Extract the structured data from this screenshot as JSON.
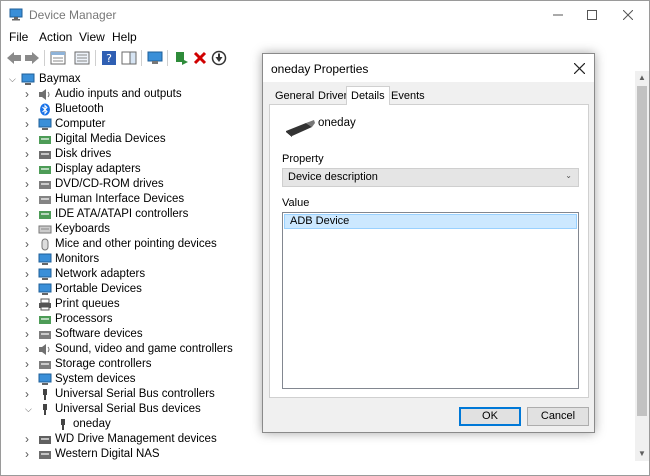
{
  "window": {
    "title": "Device Manager",
    "controls": {
      "minimize": "minimize",
      "maximize": "maximize",
      "close": "close"
    }
  },
  "menu": [
    "File",
    "Action",
    "View",
    "Help"
  ],
  "toolbar": [
    "back-arrow-icon",
    "forward-arrow-icon",
    "properties-icon",
    "show-hidden-icon",
    "help-icon",
    "action-pane-icon",
    "scan-hardware-icon",
    "update-driver-icon",
    "uninstall-icon",
    "disable-icon"
  ],
  "tree": {
    "root": "Baymax",
    "items": [
      {
        "label": "Audio inputs and outputs",
        "icon": "speaker-icon"
      },
      {
        "label": "Bluetooth",
        "icon": "bluetooth-icon"
      },
      {
        "label": "Computer",
        "icon": "monitor-icon"
      },
      {
        "label": "Digital Media Devices",
        "icon": "media-icon"
      },
      {
        "label": "Disk drives",
        "icon": "disk-icon"
      },
      {
        "label": "Display adapters",
        "icon": "display-adapter-icon"
      },
      {
        "label": "DVD/CD-ROM drives",
        "icon": "dvd-icon"
      },
      {
        "label": "Human Interface Devices",
        "icon": "hid-icon"
      },
      {
        "label": "IDE ATA/ATAPI controllers",
        "icon": "ide-icon"
      },
      {
        "label": "Keyboards",
        "icon": "keyboard-icon"
      },
      {
        "label": "Mice and other pointing devices",
        "icon": "mouse-icon"
      },
      {
        "label": "Monitors",
        "icon": "monitor-icon"
      },
      {
        "label": "Network adapters",
        "icon": "network-icon"
      },
      {
        "label": "Portable Devices",
        "icon": "portable-icon"
      },
      {
        "label": "Print queues",
        "icon": "printer-icon"
      },
      {
        "label": "Processors",
        "icon": "processor-icon"
      },
      {
        "label": "Software devices",
        "icon": "software-icon"
      },
      {
        "label": "Sound, video and game controllers",
        "icon": "sound-icon"
      },
      {
        "label": "Storage controllers",
        "icon": "storage-icon"
      },
      {
        "label": "System devices",
        "icon": "system-icon"
      },
      {
        "label": "Universal Serial Bus controllers",
        "icon": "usb-icon"
      },
      {
        "label": "Universal Serial Bus devices",
        "icon": "usb-icon",
        "expanded": true
      },
      {
        "label": "oneday",
        "icon": "usb-device-icon",
        "child": true
      },
      {
        "label": "WD Drive Management devices",
        "icon": "wd-icon"
      },
      {
        "label": "Western Digital NAS",
        "icon": "nas-icon"
      }
    ]
  },
  "dialog": {
    "title": "oneday Properties",
    "tabs": [
      "General",
      "Driver",
      "Details",
      "Events"
    ],
    "active_tab": "Details",
    "device_name": "oneday",
    "property_label": "Property",
    "property_value": "Device description",
    "value_label": "Value",
    "value_selected": "ADB Device",
    "ok_label": "OK",
    "cancel_label": "Cancel"
  },
  "colors": {
    "selection": "#cce8ff",
    "accent": "#0078d7",
    "bluetooth": "#1a73e8",
    "uninstall": "#d00000"
  }
}
